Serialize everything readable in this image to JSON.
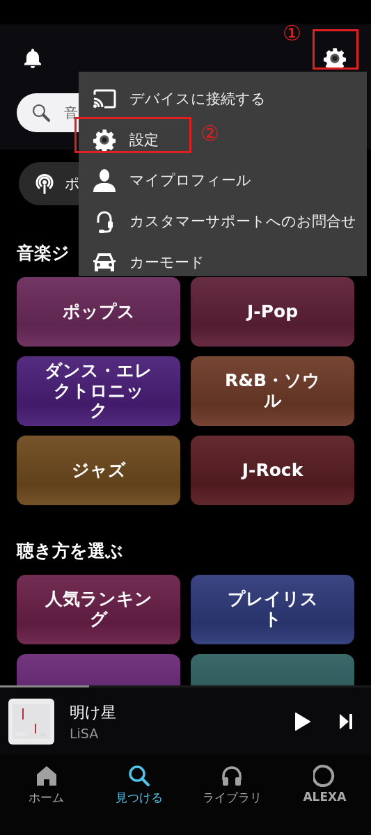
{
  "search": {
    "placeholder": "音"
  },
  "chips": [
    {
      "label": "ポ",
      "kind": "podcast"
    }
  ],
  "sections": [
    {
      "title": "音楽ジ",
      "tiles": [
        {
          "label": "ポップス",
          "color": "#6a2a5a"
        },
        {
          "label": "J-Pop",
          "color": "#5e2038"
        },
        {
          "label": "ダンス・エレクトロニック",
          "color": "#4a1f78"
        },
        {
          "label": "R&B・ソウル",
          "color": "#6e3a28"
        },
        {
          "label": "ジャズ",
          "color": "#6e4a1e"
        },
        {
          "label": "J-Rock",
          "color": "#5a1e22"
        }
      ]
    },
    {
      "title": "聴き方を選ぶ",
      "tiles": [
        {
          "label": "人気ランキング",
          "color": "#6a2048"
        },
        {
          "label": "プレイリスト",
          "color": "#2e3a7a"
        },
        {
          "color": "#6a2a78"
        },
        {
          "color": "#2f6060"
        }
      ]
    }
  ],
  "menu": {
    "items": [
      {
        "label": "デバイスに接続する",
        "kind": "cast"
      },
      {
        "label": "設定",
        "kind": "settings"
      },
      {
        "label": "マイプロフィール",
        "kind": "profile"
      },
      {
        "label": "カスタマーサポートへのお問合せ",
        "kind": "support"
      },
      {
        "label": "カーモード",
        "kind": "car"
      }
    ]
  },
  "annotations": [
    {
      "label": "①"
    },
    {
      "label": "②"
    }
  ],
  "now_playing": {
    "title": "明け星",
    "artist": "LiSA",
    "progress": {
      "level": 0.24
    }
  },
  "nav": [
    {
      "label": "ホーム",
      "kind": "home",
      "selected": false
    },
    {
      "label": "見つける",
      "kind": "search",
      "selected": true
    },
    {
      "label": "ライブラリ",
      "kind": "library",
      "selected": false
    },
    {
      "label": "ALEXA",
      "kind": "alexa",
      "selected": false
    }
  ]
}
